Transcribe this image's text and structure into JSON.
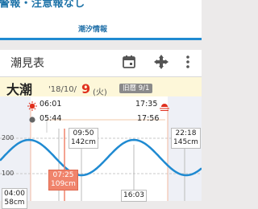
{
  "header": {
    "alert_text": "警報・注意報なし",
    "tab_label": "潮汐情報"
  },
  "toolbar": {
    "title": "潮見表"
  },
  "day": {
    "tide_type": "大潮",
    "date_prefix": "'18/10/",
    "day": "9",
    "weekday": "(火)",
    "lunar": "旧暦 9/1"
  },
  "sun_moon": {
    "sunrise": "06:01",
    "sunset": "17:35",
    "moonrise": "05:44",
    "moonset": "17:56"
  },
  "tides": [
    {
      "time": "04:00",
      "height": "58cm"
    },
    {
      "time": "07:25",
      "height": "109cm"
    },
    {
      "time": "09:50",
      "height": "142cm"
    },
    {
      "time": "16:03",
      "height": ""
    },
    {
      "time": "22:18",
      "height": "145cm"
    }
  ],
  "axis": {
    "y_labels": [
      "200",
      "100"
    ]
  },
  "colors": {
    "accent": "#1f8ad1",
    "highlight": "#f0846c",
    "sun": "#e0301e"
  }
}
